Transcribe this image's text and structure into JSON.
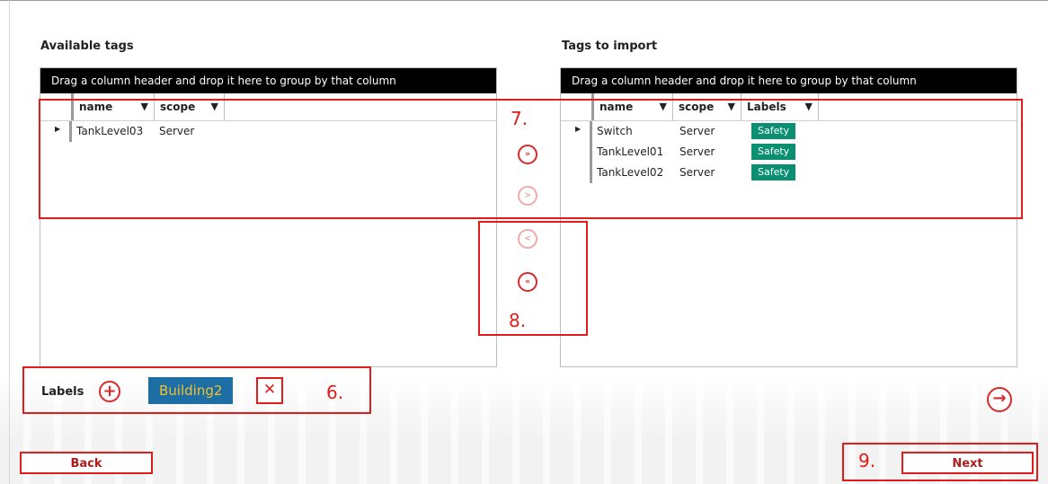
{
  "available": {
    "title": "Available tags",
    "group_hint": "Drag a column header and drop it here to group by that column",
    "columns": [
      "name",
      "scope"
    ],
    "rows": [
      {
        "name": "TankLevel03",
        "scope": "Server"
      }
    ]
  },
  "import": {
    "title": "Tags to import",
    "group_hint": "Drag a column header and drop it here to group by that column",
    "columns": [
      "name",
      "scope",
      "Labels"
    ],
    "rows": [
      {
        "name": "Switch",
        "scope": "Server",
        "label": "Safety"
      },
      {
        "name": "TankLevel01",
        "scope": "Server",
        "label": "Safety"
      },
      {
        "name": "TankLevel02",
        "scope": "Server",
        "label": "Safety"
      }
    ]
  },
  "transfer": {
    "add_all": "»",
    "add_one": ">",
    "remove_one": "<",
    "remove_all": "«"
  },
  "labels": {
    "caption": "Labels",
    "add_symbol": "+",
    "chip": "Building2",
    "remove_symbol": "✕"
  },
  "annotations": {
    "six": "6.",
    "seven": "7.",
    "eight": "8.",
    "nine": "9."
  },
  "footer": {
    "back": "Back",
    "next": "Next",
    "forward_symbol": "→"
  },
  "colors": {
    "annotation": "#e21b1b",
    "badge": "#0a8f73",
    "chip_bg": "#1c6ea4",
    "chip_text": "#f2c230"
  }
}
